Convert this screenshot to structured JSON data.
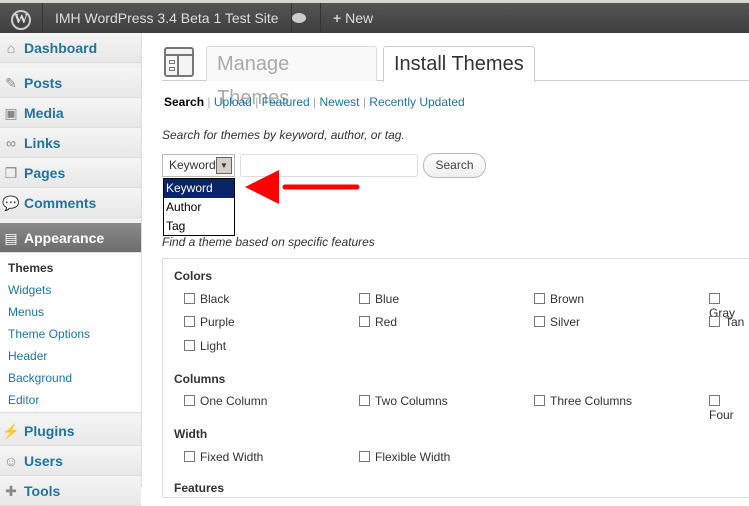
{
  "adminbar": {
    "site": "IMH WordPress 3.4 Beta 1 Test Site",
    "new": "New",
    "icons": [
      "wordpress-logo",
      "comment-bubble",
      "plus"
    ]
  },
  "sidebar": {
    "items": [
      {
        "label": "Dashboard",
        "icon": "home"
      },
      {
        "label": "Posts",
        "icon": "pin"
      },
      {
        "label": "Media",
        "icon": "media"
      },
      {
        "label": "Links",
        "icon": "link"
      },
      {
        "label": "Pages",
        "icon": "pages"
      },
      {
        "label": "Comments",
        "icon": "comment"
      },
      {
        "label": "Appearance",
        "icon": "appearance"
      },
      {
        "label": "Plugins",
        "icon": "plug"
      },
      {
        "label": "Users",
        "icon": "users"
      },
      {
        "label": "Tools",
        "icon": "tools"
      }
    ],
    "submenu": [
      "Themes",
      "Widgets",
      "Menus",
      "Theme Options",
      "Header",
      "Background",
      "Editor"
    ]
  },
  "tabs": [
    "Manage Themes",
    "Install Themes"
  ],
  "subnav": [
    "Search",
    "Upload",
    "Featured",
    "Newest",
    "Recently Updated"
  ],
  "search": {
    "hint": "Search for themes by keyword, author, or tag.",
    "select_value": "Keyword",
    "options": [
      "Keyword",
      "Author",
      "Tag"
    ],
    "input_value": "",
    "button": "Search"
  },
  "features": {
    "hint": "Find a theme based on specific features",
    "groups": [
      {
        "title": "Colors",
        "items": [
          "Black",
          "Blue",
          "Brown",
          "Gray",
          "Purple",
          "Red",
          "Silver",
          "Tan",
          "Light"
        ]
      },
      {
        "title": "Columns",
        "items": [
          "One Column",
          "Two Columns",
          "Three Columns",
          "Four"
        ]
      },
      {
        "title": "Width",
        "items": [
          "Fixed Width",
          "Flexible Width"
        ]
      },
      {
        "title": "Features",
        "items": []
      }
    ]
  },
  "annotation_color": "#ff0000"
}
